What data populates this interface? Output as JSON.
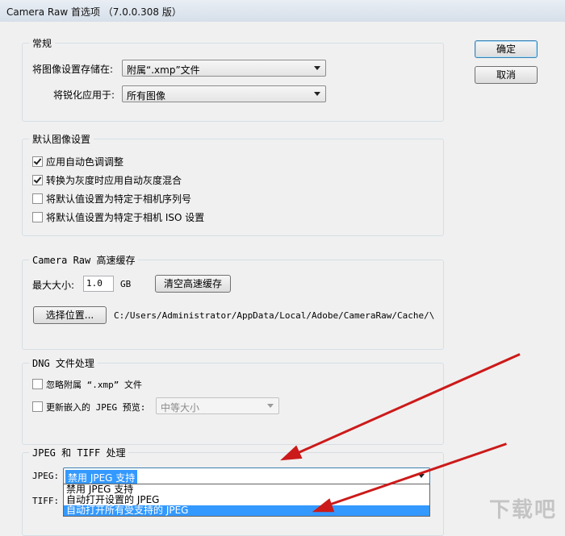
{
  "window": {
    "title": "Camera Raw 首选项 （7.0.0.308 版）"
  },
  "buttons": {
    "ok": "确定",
    "cancel": "取消"
  },
  "general": {
    "legend": "常规",
    "save_label": "将图像设置存储在:",
    "save_value": "附属“.xmp”文件",
    "sharpen_label": "将锐化应用于:",
    "sharpen_value": "所有图像"
  },
  "defaults": {
    "legend": "默认图像设置",
    "items": [
      {
        "label": "应用自动色调调整",
        "checked": true
      },
      {
        "label": "转换为灰度时应用自动灰度混合",
        "checked": true
      },
      {
        "label": "将默认值设置为特定于相机序列号",
        "checked": false
      },
      {
        "label": "将默认值设置为特定于相机 ISO 设置",
        "checked": false
      }
    ]
  },
  "cache": {
    "legend": "Camera Raw 高速缓存",
    "max_label": "最大大小:",
    "max_value": "1.0",
    "unit": "GB",
    "purge_button": "清空高速缓存",
    "location_button": "选择位置...",
    "path": "C:/Users/Administrator/AppData/Local/Adobe/CameraRaw/Cache/\\"
  },
  "dng": {
    "legend": "DNG 文件处理",
    "ignore_label": "忽略附属 “.xmp” 文件",
    "update_label": "更新嵌入的 JPEG 预览:",
    "preview_value": "中等大小"
  },
  "jpeg": {
    "legend": "JPEG 和 TIFF 处理",
    "jpeg_label": "JPEG:",
    "jpeg_value": "禁用 JPEG 支持",
    "tiff_label": "TIFF:",
    "options": [
      "禁用 JPEG 支持",
      "自动打开设置的 JPEG",
      "自动打开所有受支持的 JPEG"
    ]
  },
  "colors": {
    "annotation": "#cc1a1a",
    "selection": "#3399ff"
  },
  "watermark": "下载吧"
}
